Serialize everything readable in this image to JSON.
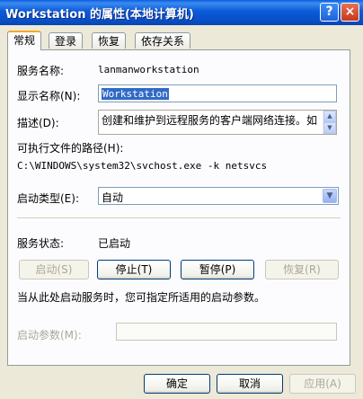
{
  "titlebar": {
    "title": "Workstation 的属性(本地计算机)",
    "help_label": "?",
    "close_label": "×"
  },
  "tabs": [
    "常规",
    "登录",
    "恢复",
    "依存关系"
  ],
  "general": {
    "service_name_label": "服务名称:",
    "service_name_value": "lanmanworkstation",
    "display_name_label": "显示名称(N):",
    "display_name_value": "Workstation",
    "description_label": "描述(D):",
    "description_value": "创建和维护到远程服务的客户端网络连接。如",
    "exec_path_label": "可执行文件的路径(H):",
    "exec_path_value": "C:\\WINDOWS\\system32\\svchost.exe -k netsvcs",
    "startup_type_label": "启动类型(E):",
    "startup_type_value": "自动",
    "service_status_label": "服务状态:",
    "service_status_value": "已启动",
    "buttons": {
      "start": "启动(S)",
      "stop": "停止(T)",
      "pause": "暂停(P)",
      "resume": "恢复(R)"
    },
    "hint": "当从此处启动服务时，您可指定所适用的启动参数。",
    "start_params_label": "启动参数(M):",
    "start_params_value": ""
  },
  "footer": {
    "ok": "确定",
    "cancel": "取消",
    "apply": "应用(A)"
  }
}
